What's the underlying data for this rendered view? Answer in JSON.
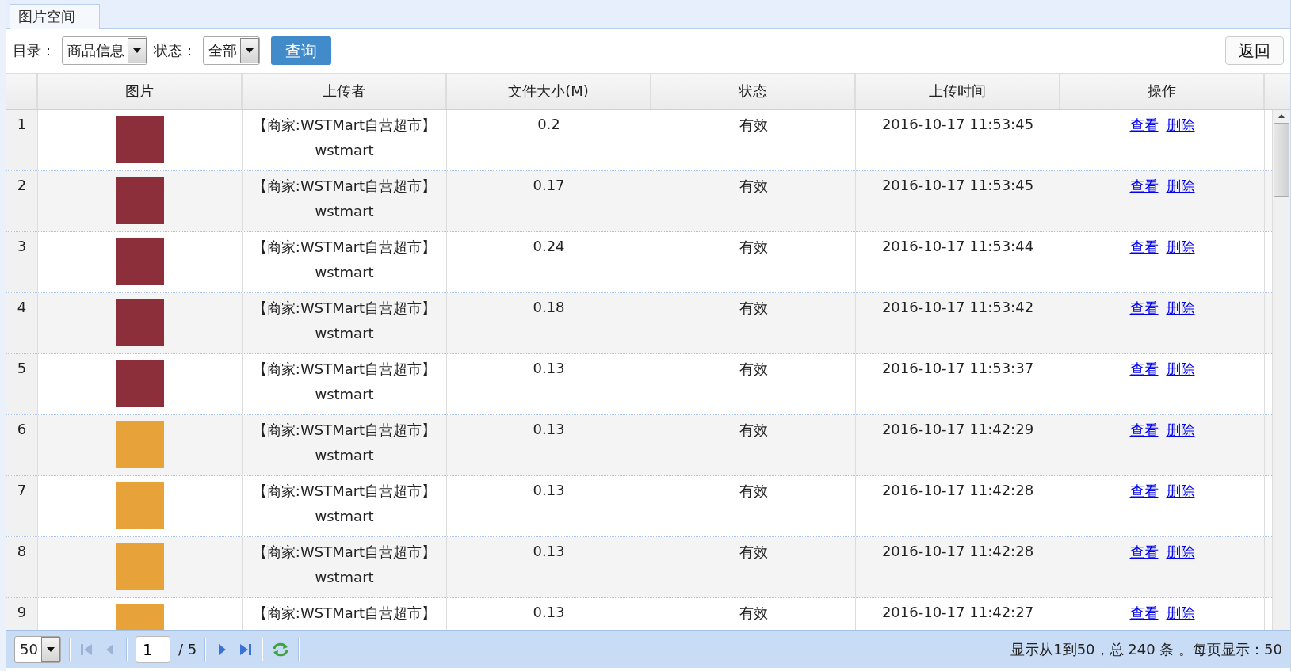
{
  "tab": {
    "label": "图片空间",
    "selected": true
  },
  "filters": [
    {
      "label": "目录：",
      "value": "商品信息"
    },
    {
      "label": "状态：",
      "value": "全部"
    }
  ],
  "query_button": "查询",
  "back_button": "返回",
  "table": {
    "columns": [
      "图片",
      "上传者",
      "文件大小(M)",
      "状态",
      "上传时间",
      "操作"
    ],
    "rows": [
      {
        "index": "1",
        "kind": "grape",
        "uploader": [
          "【商家:WSTMart自营超市】",
          "wstmart"
        ],
        "size": "0.2",
        "status": "有效",
        "time": "2016-10-17 11:53:45",
        "actions": [
          "查看",
          "删除"
        ]
      },
      {
        "index": "2",
        "kind": "grape",
        "uploader": [
          "【商家:WSTMart自营超市】",
          "wstmart"
        ],
        "size": "0.17",
        "status": "有效",
        "time": "2016-10-17 11:53:45",
        "actions": [
          "查看",
          "删除"
        ]
      },
      {
        "index": "3",
        "kind": "grape",
        "uploader": [
          "【商家:WSTMart自营超市】",
          "wstmart"
        ],
        "size": "0.24",
        "status": "有效",
        "time": "2016-10-17 11:53:44",
        "actions": [
          "查看",
          "删除"
        ]
      },
      {
        "index": "4",
        "kind": "grape",
        "uploader": [
          "【商家:WSTMart自营超市】",
          "wstmart"
        ],
        "size": "0.18",
        "status": "有效",
        "time": "2016-10-17 11:53:42",
        "actions": [
          "查看",
          "删除"
        ]
      },
      {
        "index": "5",
        "kind": "grape",
        "uploader": [
          "【商家:WSTMart自营超市】",
          "wstmart"
        ],
        "size": "0.13",
        "status": "有效",
        "time": "2016-10-17 11:53:37",
        "actions": [
          "查看",
          "删除"
        ]
      },
      {
        "index": "6",
        "kind": "orange",
        "uploader": [
          "【商家:WSTMart自营超市】",
          "wstmart"
        ],
        "size": "0.13",
        "status": "有效",
        "time": "2016-10-17 11:42:29",
        "actions": [
          "查看",
          "删除"
        ]
      },
      {
        "index": "7",
        "kind": "orange",
        "uploader": [
          "【商家:WSTMart自营超市】",
          "wstmart"
        ],
        "size": "0.13",
        "status": "有效",
        "time": "2016-10-17 11:42:28",
        "actions": [
          "查看",
          "删除"
        ]
      },
      {
        "index": "8",
        "kind": "orange",
        "uploader": [
          "【商家:WSTMart自营超市】",
          "wstmart"
        ],
        "size": "0.13",
        "status": "有效",
        "time": "2016-10-17 11:42:28",
        "actions": [
          "查看",
          "删除"
        ]
      },
      {
        "index": "9",
        "kind": "orange",
        "uploader": [
          "【商家:WSTMart自营超市】"
        ],
        "size": "0.13",
        "status": "有效",
        "time": "2016-10-17 11:42:27",
        "actions": [
          "查看",
          "删除"
        ]
      }
    ]
  },
  "pager": {
    "page_size": "50",
    "page": "1",
    "total_pages": "/ 5",
    "summary": "显示从1到50，总 240 条 。每页显示：50"
  }
}
